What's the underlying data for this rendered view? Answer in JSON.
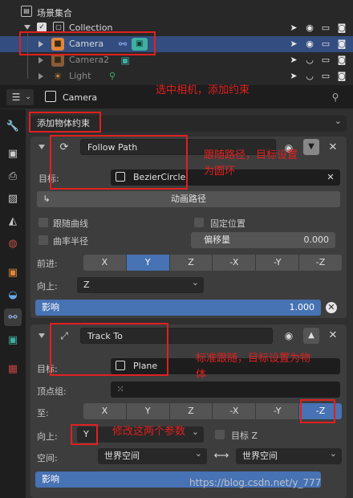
{
  "outliner": {
    "scene_collection": "场景集合",
    "items": [
      {
        "label": "Collection"
      },
      {
        "label": "Camera"
      },
      {
        "label": "Camera2"
      },
      {
        "label": "Light"
      }
    ]
  },
  "properties": {
    "object_name": "Camera",
    "add_constraint": "添加物体约束"
  },
  "follow_path": {
    "name": "Follow Path",
    "target_label": "目标:",
    "target": "BezierCircle",
    "animate_path": "动画路径",
    "follow_curve": "跟随曲线",
    "fixed_position": "固定位置",
    "curve_radius": "曲率半径",
    "offset_label": "偏移量",
    "offset_value": "0.000",
    "forward_label": "前进:",
    "forward_axes": [
      "X",
      "Y",
      "Z",
      "-X",
      "-Y",
      "-Z"
    ],
    "forward_selected": "Y",
    "up_label": "向上:",
    "up_value": "Z",
    "influence_label": "影响",
    "influence_value": "1.000",
    "influence_fraction": 1.0
  },
  "track_to": {
    "name": "Track To",
    "target_label": "目标:",
    "target": "Plane",
    "vertex_group_label": "顶点组:",
    "to_label": "至:",
    "to_axes": [
      "X",
      "Y",
      "Z",
      "-X",
      "-Y",
      "-Z"
    ],
    "to_selected": "-Z",
    "up_label": "向上:",
    "up_value": "Y",
    "target_z": "目标 Z",
    "space_label": "空间:",
    "owner_space": "世界空间",
    "target_space": "世界空间",
    "influence_label": "影响",
    "influence_fraction": 1.0
  },
  "annotations": {
    "select_camera": "选中相机，添加约束",
    "follow_path_note_1": "跟随路径，目标设置",
    "follow_path_note_2": "为圆环",
    "track_note_1": "标准跟随，目标设置为物",
    "track_note_2": "体",
    "modify_note": "修改这两个参数"
  },
  "watermark": "https://blog.csdn.net/y_777",
  "colors": {
    "accent": "#4772b3",
    "selected_row": "#334d80",
    "annotation": "#e02020",
    "camera_orange": "#e0873c",
    "constraint_teal": "#3eb0a0"
  }
}
